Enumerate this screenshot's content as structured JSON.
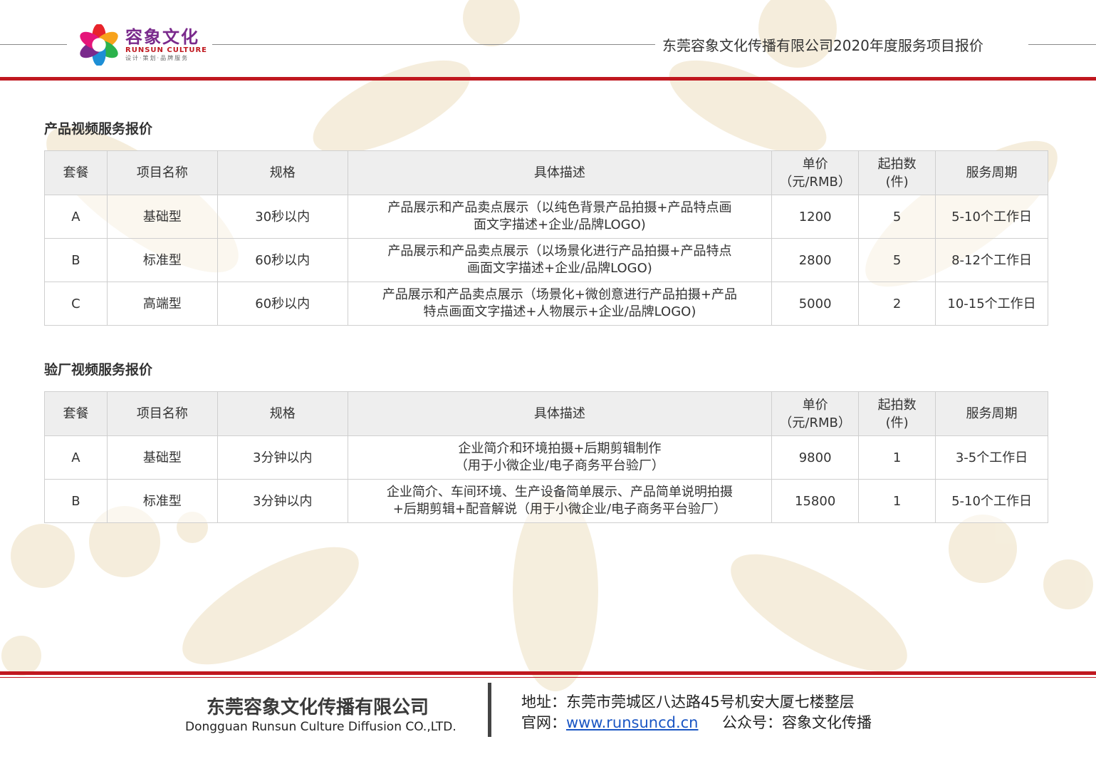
{
  "header": {
    "logo_cn": "容象文化",
    "logo_en": "RUNSUN CULTURE",
    "logo_tag": "设计·策划·品牌服务",
    "title": "东莞容象文化传播有限公司2020年度服务项目报价"
  },
  "section1": {
    "title": "产品视频服务报价",
    "headers": [
      "套餐",
      "项目名称",
      "规格",
      "具体描述",
      "单价",
      "（元/RMB）",
      "起拍数",
      "(件)",
      "服务周期"
    ],
    "rows": [
      {
        "pkg": "A",
        "name": "基础型",
        "spec": "30秒以内",
        "desc1": "产品展示和产品卖点展示（以纯色背景产品拍摄+产品特点画",
        "desc2": "面文字描述+企业/品牌LOGO)",
        "price": "1200",
        "min": "5",
        "cycle": "5-10个工作日"
      },
      {
        "pkg": "B",
        "name": "标准型",
        "spec": "60秒以内",
        "desc1": "产品展示和产品卖点展示（以场景化进行产品拍摄+产品特点",
        "desc2": "画面文字描述+企业/品牌LOGO)",
        "price": "2800",
        "min": "5",
        "cycle": "8-12个工作日"
      },
      {
        "pkg": "C",
        "name": "高端型",
        "spec": "60秒以内",
        "desc1": "产品展示和产品卖点展示（场景化+微创意进行产品拍摄+产品",
        "desc2": "特点画面文字描述+人物展示+企业/品牌LOGO)",
        "price": "5000",
        "min": "2",
        "cycle": "10-15个工作日"
      }
    ]
  },
  "section2": {
    "title": "验厂视频服务报价",
    "headers": [
      "套餐",
      "项目名称",
      "规格",
      "具体描述",
      "单价",
      "（元/RMB）",
      "起拍数",
      "(件)",
      "服务周期"
    ],
    "rows": [
      {
        "pkg": "A",
        "name": "基础型",
        "spec": "3分钟以内",
        "desc1": "企业简介和环境拍摄+后期剪辑制作",
        "desc2": "（用于小微企业/电子商务平台验厂）",
        "price": "9800",
        "min": "1",
        "cycle": "3-5个工作日"
      },
      {
        "pkg": "B",
        "name": "标准型",
        "spec": "3分钟以内",
        "desc1": "企业简介、车间环境、生产设备简单展示、产品简单说明拍摄",
        "desc2": "+后期剪辑+配音解说（用于小微企业/电子商务平台验厂）",
        "price": "15800",
        "min": "1",
        "cycle": "5-10个工作日"
      }
    ]
  },
  "footer": {
    "company_cn": "东莞容象文化传播有限公司",
    "company_en": "Dongguan Runsun Culture Diffusion CO.,LTD.",
    "addr_label": "地址：",
    "addr": "东莞市莞城区八达路45号机安大厦七楼整层",
    "web_label": "官网：",
    "web": "www.runsuncd.cn",
    "wx_label": "公众号：",
    "wx": "容象文化传播"
  },
  "colors": {
    "accent_red": "#c0181f",
    "deco_beige": "#f3ead6",
    "header_gray": "#eeeeee"
  }
}
